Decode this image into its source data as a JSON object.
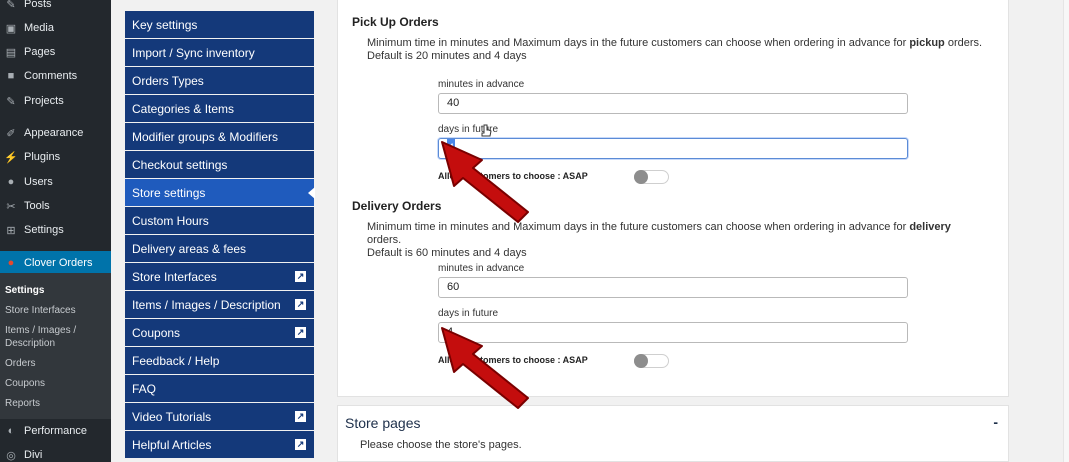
{
  "wp_menu": {
    "items": [
      {
        "icon": "pin-icon",
        "label": "Posts"
      },
      {
        "icon": "media-icon",
        "label": "Media"
      },
      {
        "icon": "pages-icon",
        "label": "Pages"
      },
      {
        "icon": "comments-icon",
        "label": "Comments"
      },
      {
        "icon": "pin-icon",
        "label": "Projects"
      },
      {
        "icon": "brush-icon",
        "label": "Appearance"
      },
      {
        "icon": "plug-icon",
        "label": "Plugins"
      },
      {
        "icon": "user-icon",
        "label": "Users"
      },
      {
        "icon": "wrench-icon",
        "label": "Tools"
      },
      {
        "icon": "settings-icon",
        "label": "Settings"
      },
      {
        "icon": "clover-icon",
        "label": "Clover Orders"
      },
      {
        "icon": "gauge-icon",
        "label": "Performance"
      },
      {
        "icon": "divi-icon",
        "label": "Divi"
      }
    ],
    "submenu": [
      "Settings",
      "Store Interfaces",
      "Items / Images /",
      "Description",
      "Orders",
      "Coupons",
      "Reports"
    ]
  },
  "plugin_nav": {
    "items": [
      {
        "label": "Key settings"
      },
      {
        "label": "Import / Sync inventory"
      },
      {
        "label": "Orders Types"
      },
      {
        "label": "Categories & Items"
      },
      {
        "label": "Modifier groups & Modifiers"
      },
      {
        "label": "Checkout settings"
      },
      {
        "label": "Store settings"
      },
      {
        "label": "Custom Hours"
      },
      {
        "label": "Delivery areas & fees"
      },
      {
        "label": "Store Interfaces"
      },
      {
        "label": "Items / Images / Description"
      },
      {
        "label": "Coupons"
      },
      {
        "label": "Feedback / Help"
      },
      {
        "label": "FAQ"
      },
      {
        "label": "Video Tutorials"
      },
      {
        "label": "Helpful Articles"
      }
    ]
  },
  "pickup": {
    "title": "Pick Up Orders",
    "desc_pre": "Minimum time in minutes and Maximum days in the future customers can choose when ordering in advance for ",
    "desc_bold": "pickup",
    "desc_post": " orders.",
    "desc_line2": "Default is 20 minutes and 4 days",
    "minutes_label": "minutes in advance",
    "minutes_value": "40",
    "days_label": "days in future",
    "days_value": "4",
    "allow_label": "Allow customers to choose : ASAP"
  },
  "delivery": {
    "title": "Delivery Orders",
    "desc_pre": "Minimum time in minutes and Maximum days in the future customers can choose when ordering in advance for ",
    "desc_bold": "delivery",
    "desc_post": " orders.",
    "desc_line2": "Default is 60 minutes and 4 days",
    "minutes_label": "minutes in advance",
    "minutes_value": "60",
    "days_label": "days in future",
    "days_value": "4",
    "allow_label": "Allow customers to choose : ASAP"
  },
  "store_pages": {
    "title": "Store pages",
    "toggle": "-",
    "subtitle": "Please choose the store's pages."
  },
  "colors": {
    "nav_bg": "#14397a",
    "nav_selected": "#1f5bbd",
    "wp_menu_bg": "#23282d",
    "wp_active": "#0073aa",
    "arrow_red": "#c40d0d"
  }
}
